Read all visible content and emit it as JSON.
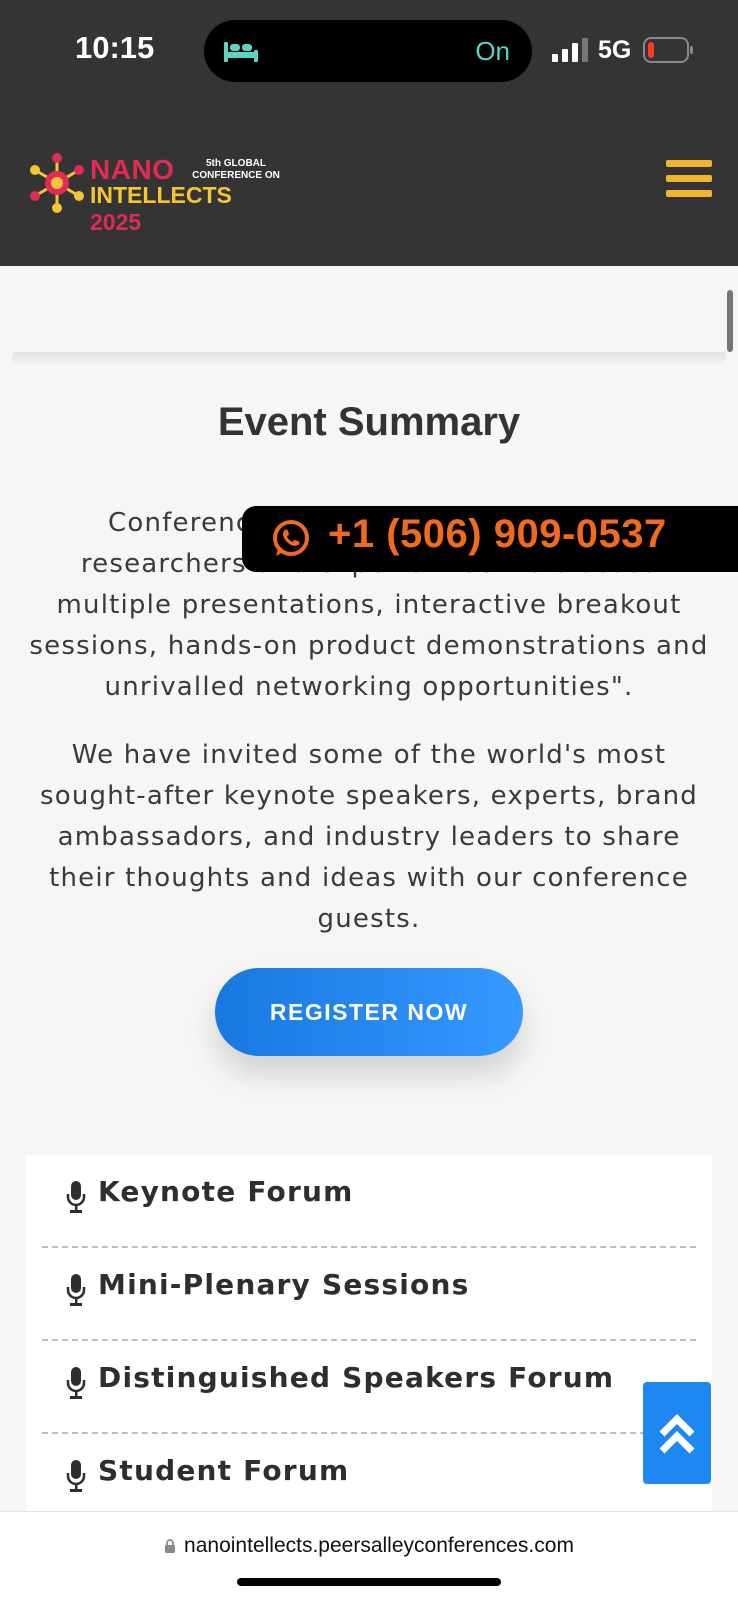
{
  "status_bar": {
    "time": "10:15",
    "focus_status": "On",
    "network": "5G"
  },
  "header": {
    "logo": {
      "line1": "NANO",
      "sub_line1": "5th GLOBAL",
      "sub_line2": "CONFERENCE ON",
      "line2_a": "INTELLECTS",
      "line2_b": "2025"
    },
    "menu_icon": "hamburger-icon"
  },
  "section": {
    "title_bold": "Event",
    "title_rest": "Summary",
    "para1": "Conferences are a great place where researchers and experts meet to discuss multiple presentations, interactive breakout sessions, hands-on product demonstrations and unrivalled networking opportunities\".",
    "para2": "We have invited some of the world's most sought-after keynote speakers, experts, brand ambassadors, and industry leaders to share their thoughts and ideas with our conference guests."
  },
  "phone_banner": {
    "number": "+1 (506) 909-0537",
    "icon": "whatsapp-icon"
  },
  "register_button": "REGISTER NOW",
  "forums": [
    {
      "label": "Keynote Forum",
      "icon": "microphone-icon"
    },
    {
      "label": "Mini-Plenary Sessions",
      "icon": "microphone-icon"
    },
    {
      "label": "Distinguished Speakers Forum",
      "icon": "microphone-icon"
    },
    {
      "label": "Student Forum",
      "icon": "microphone-icon"
    }
  ],
  "browser": {
    "url": "nanointellects.peersalleyconferences.com"
  },
  "colors": {
    "header_bg": "#343434",
    "accent_blue": "#1e88f0",
    "phone_orange": "#f26a1b",
    "logo_red": "#e02b56",
    "logo_yellow": "#f6c532"
  }
}
